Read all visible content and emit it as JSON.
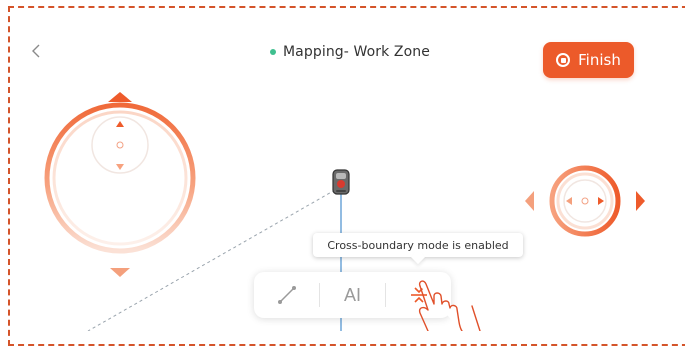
{
  "header": {
    "title": "Mapping- Work Zone",
    "status_color": "#3fbf8f"
  },
  "finish_button": {
    "label": "Finish",
    "color": "#ec5a2a"
  },
  "tooltip": {
    "text": "Cross-boundary mode is enabled"
  },
  "toolbar": {
    "tools": [
      {
        "name": "line-tool",
        "icon": "line-icon"
      },
      {
        "name": "ai-tool",
        "label": "AI"
      },
      {
        "name": "cross-boundary-tool",
        "icon": "cross-boundary-icon",
        "active": true
      }
    ]
  },
  "left_joystick": {
    "icon": "joystick-vertical-icon"
  },
  "right_joystick": {
    "icon": "joystick-horizontal-icon"
  },
  "robot": {
    "icon": "robot-mower-icon"
  },
  "accent_color": "#ec5a2a"
}
